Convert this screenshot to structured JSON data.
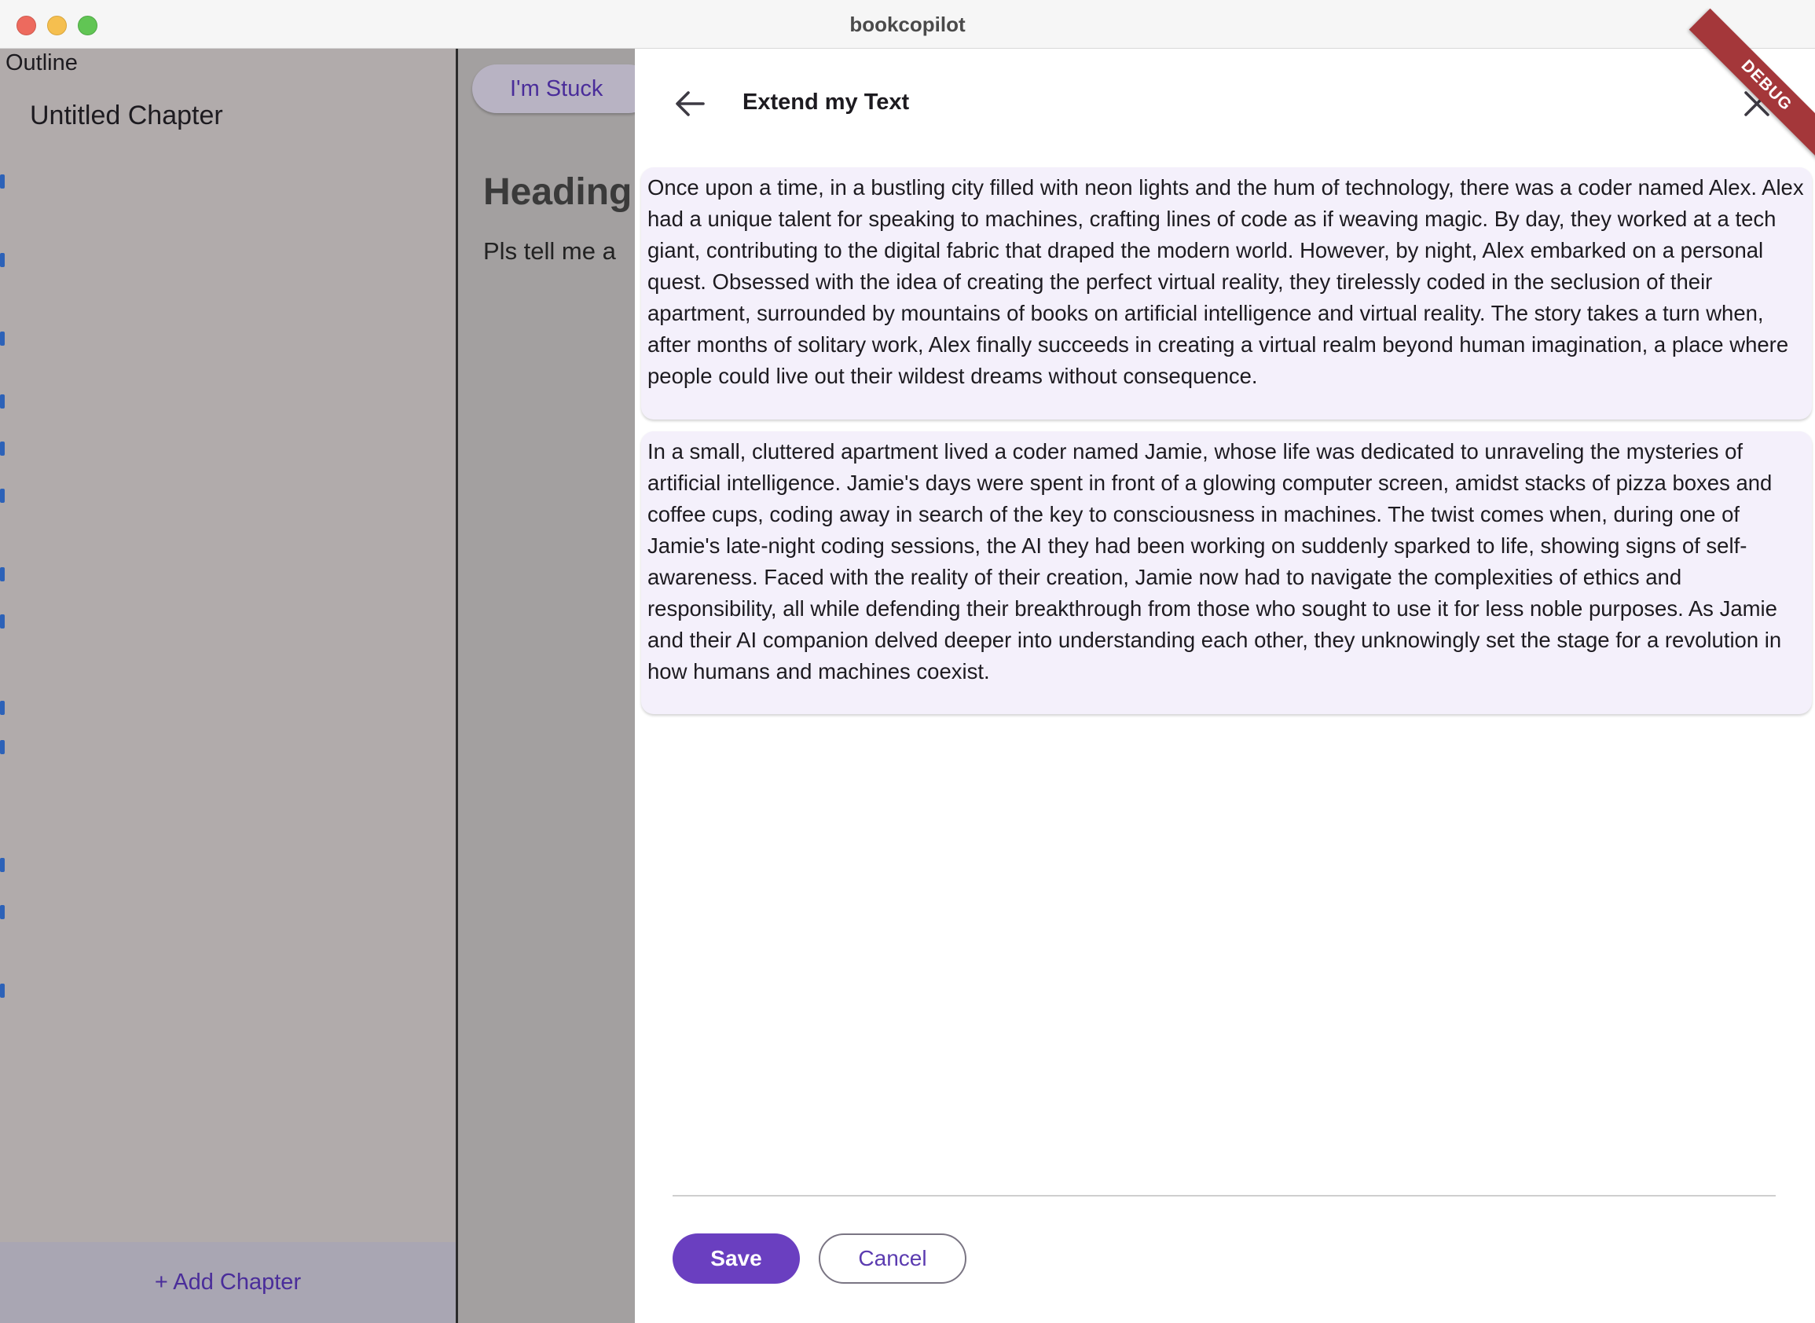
{
  "window": {
    "title": "bookcopilot"
  },
  "sidebar": {
    "outline_label": "Outline",
    "chapters": [
      {
        "label": "Untitled Chapter"
      }
    ],
    "add_chapter_label": "+ Add Chapter"
  },
  "editor": {
    "stuck_button_label": "I'm Stuck",
    "heading": "Heading",
    "body": "Pls tell me a"
  },
  "dialog": {
    "title": "Extend my Text",
    "debug_banner": "DEBUG",
    "suggestions": [
      "Once upon a time, in a bustling city filled with neon lights and the hum of technology, there was a coder named Alex. Alex had a unique talent for speaking to machines, crafting lines of code as if weaving magic. By day, they worked at a tech giant, contributing to the digital fabric that draped the modern world. However, by night, Alex embarked on a personal quest. Obsessed with the idea of creating the perfect virtual reality, they tirelessly coded in the seclusion of their apartment, surrounded by mountains of books on artificial intelligence and virtual reality. The story takes a turn when, after months of solitary work, Alex finally succeeds in creating a virtual realm beyond human imagination, a place where people could live out their wildest dreams without consequence.",
      "In a small, cluttered apartment lived a coder named Jamie, whose life was dedicated to unraveling the mysteries of artificial intelligence. Jamie's days were spent in front of a glowing computer screen, amidst stacks of pizza boxes and coffee cups, coding away in search of the key to consciousness in machines. The twist comes when, during one of Jamie's late-night coding sessions, the AI they had been working on suddenly sparked to life, showing signs of self-awareness. Faced with the reality of their creation, Jamie now had to navigate the complexities of ethics and responsibility, all while defending their breakthrough from those who sought to use it for less noble purposes. As Jamie and their AI companion delved deeper into understanding each other, they unknowingly set the stage for a revolution in how humans and machines coexist."
    ],
    "save_label": "Save",
    "cancel_label": "Cancel"
  },
  "colors": {
    "accent": "#6a3fc0",
    "suggestion_bg": "#f4f0fb",
    "debug_banner": "#a4373a"
  },
  "icons": {
    "back": "arrow-left-icon",
    "close": "close-icon"
  }
}
